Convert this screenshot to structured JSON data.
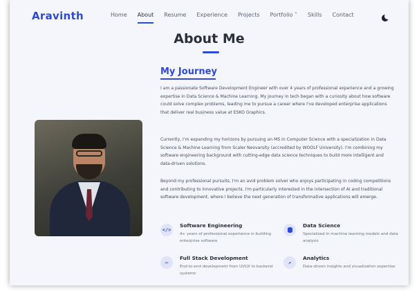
{
  "nav": {
    "brand": "Aravinth",
    "items": [
      "Home",
      "About",
      "Resume",
      "Experience",
      "Projects",
      "Portfolio ˅",
      "Skills",
      "Contact"
    ],
    "active": "About",
    "theme_toggle": "moon-icon"
  },
  "about": {
    "title": "About Me",
    "journey_heading": "My Journey",
    "paragraphs": [
      "I am a passionate Software Development Engineer with over 4 years of professional experience and a growing expertise in Data Science & Machine Learning. My journey in tech began with a curiosity about how software could solve complex problems, leading me to pursue a career where I've developed enterprise applications that deliver real business value at ESKO Graphics.",
      "Currently, I'm expanding my horizons by pursuing an MS in Computer Science with a specialization in Data Science & Machine Learning from Scaler Neovarsity (accredited by WOOLF University). I'm combining my software engineering background with cutting-edge data science techniques to build more intelligent and data-driven solutions.",
      "Beyond my professional pursuits, I'm an avid problem solver who enjoys participating in coding competitions and contributing to innovative projects. I'm particularly interested in the intersection of AI and traditional software development, where I believe the next generation of transformative applications will emerge."
    ],
    "features": [
      {
        "icon": "code-icon",
        "glyph": "</>",
        "title": "Software Engineering",
        "desc": "4+ years of professional experience in building enterprise software"
      },
      {
        "icon": "database-icon",
        "glyph": "",
        "title": "Data Science",
        "desc": "Specialized in machine learning models and data analysis"
      },
      {
        "icon": "laptop-icon",
        "glyph": "▭",
        "title": "Full Stack Development",
        "desc": "End-to-end development from UI/UX to backend systems"
      },
      {
        "icon": "chart-line-icon",
        "glyph": "↗",
        "title": "Analytics",
        "desc": "Data-driven insights and visualization expertise"
      }
    ]
  },
  "colors": {
    "accent": "#2f4ad0",
    "background": "#f4f6fb",
    "text": "#2b2f3a"
  }
}
